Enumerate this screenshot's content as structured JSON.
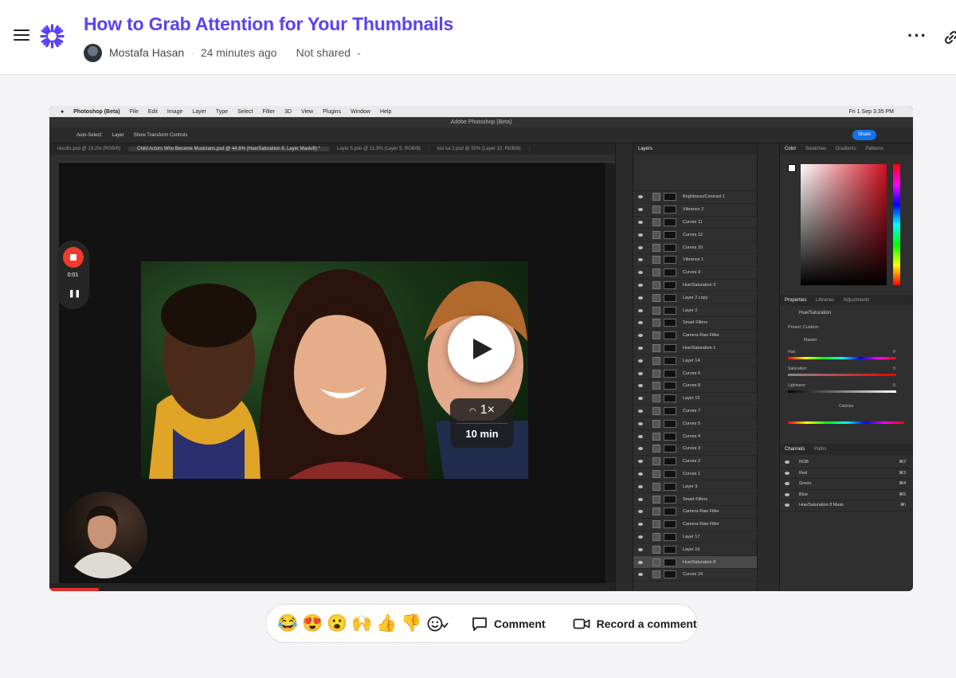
{
  "header": {
    "title": "How to Grab Attention for Your Thumbnails",
    "author": "Mostafa Hasan",
    "time": "24 minutes ago",
    "sharing": "Not shared"
  },
  "video": {
    "rec_time": "0:01",
    "speed": "1×",
    "duration": "10 min",
    "progress": 0.057,
    "photoshop": {
      "menu": [
        "Photoshop (Beta)",
        "File",
        "Edit",
        "Image",
        "Layer",
        "Type",
        "Select",
        "Filter",
        "3D",
        "View",
        "Plugins",
        "Window",
        "Help"
      ],
      "clock": "Fri 1 Sep  3:35 PM",
      "window_title": "Adobe Photoshop (Beta)",
      "share_label": "Share",
      "options": [
        "Auto-Select:",
        "Layer",
        "Show Transform Controls"
      ],
      "tabs": [
        {
          "label": "results.psd @ 19.2% (RGB/8)",
          "active": false
        },
        {
          "label": "Child Actors Who Became Musicians.psd @ 44.8% (Hue/Saturation 8, Layer Mask/8) *",
          "active": true
        },
        {
          "label": "Layer 5.psb @ 21.9% (Layer 5, RGB/8)",
          "active": false
        },
        {
          "label": "kisi ka 2.psd @ 50% (Layer 10, RGB/8)",
          "active": false
        }
      ],
      "layers_tab": "Layers",
      "layers": [
        "Brightness/Contrast 1",
        "Vibrance 2",
        "Curves 11",
        "Curves 12",
        "Curves 10",
        "Vibrance 1",
        "Curves 9",
        "Hue/Saturation 3",
        "Layer 2 copy",
        "Layer 2",
        "Smart Filters",
        "Camera Raw Filter",
        "Hue/Saturation 1",
        "Layer 14",
        "Curves 6",
        "Curves 8",
        "Layer 15",
        "Curves 7",
        "Curves 5",
        "Curves 4",
        "Curves 3",
        "Curves 2",
        "Curves 1",
        "Layer 3",
        "Smart Filters",
        "Camera Raw Filter",
        "Camera Raw Filter",
        "Layer 17",
        "Layer 16",
        "Hue/Saturation 8",
        "Curves 24"
      ],
      "color_tabs": [
        "Color",
        "Swatches",
        "Gradients",
        "Patterns"
      ],
      "props_tabs": [
        "Properties",
        "Libraries",
        "Adjustments"
      ],
      "props_title": "Hue/Saturation",
      "preset": "Custom",
      "channel": "Master",
      "sliders": [
        {
          "label": "Hue:",
          "value": "0"
        },
        {
          "label": "Saturation:",
          "value": "0"
        },
        {
          "label": "Lightness:",
          "value": "0"
        }
      ],
      "colorize_label": "Colorize",
      "channels_tabs": [
        "Channels",
        "Paths"
      ],
      "channels": [
        {
          "name": "RGB",
          "key": "⌘2"
        },
        {
          "name": "Red",
          "key": "⌘3"
        },
        {
          "name": "Green",
          "key": "⌘4"
        },
        {
          "name": "Blue",
          "key": "⌘5"
        },
        {
          "name": "Hue/Saturation 8 Mask",
          "key": "⌘\\"
        }
      ]
    }
  },
  "reactions": {
    "emojis": [
      {
        "name": "joy",
        "glyph": "😂"
      },
      {
        "name": "heart-eyes",
        "glyph": "😍"
      },
      {
        "name": "surprised",
        "glyph": "😮"
      },
      {
        "name": "raised-hands",
        "glyph": "🙌"
      },
      {
        "name": "thumbs-up",
        "glyph": "👍"
      },
      {
        "name": "thumbs-down",
        "glyph": "👎"
      }
    ],
    "comment_label": "Comment",
    "record_label": "Record a comment"
  },
  "colors": {
    "brand": "#5a42f5",
    "record_red": "#ef3b2e"
  }
}
